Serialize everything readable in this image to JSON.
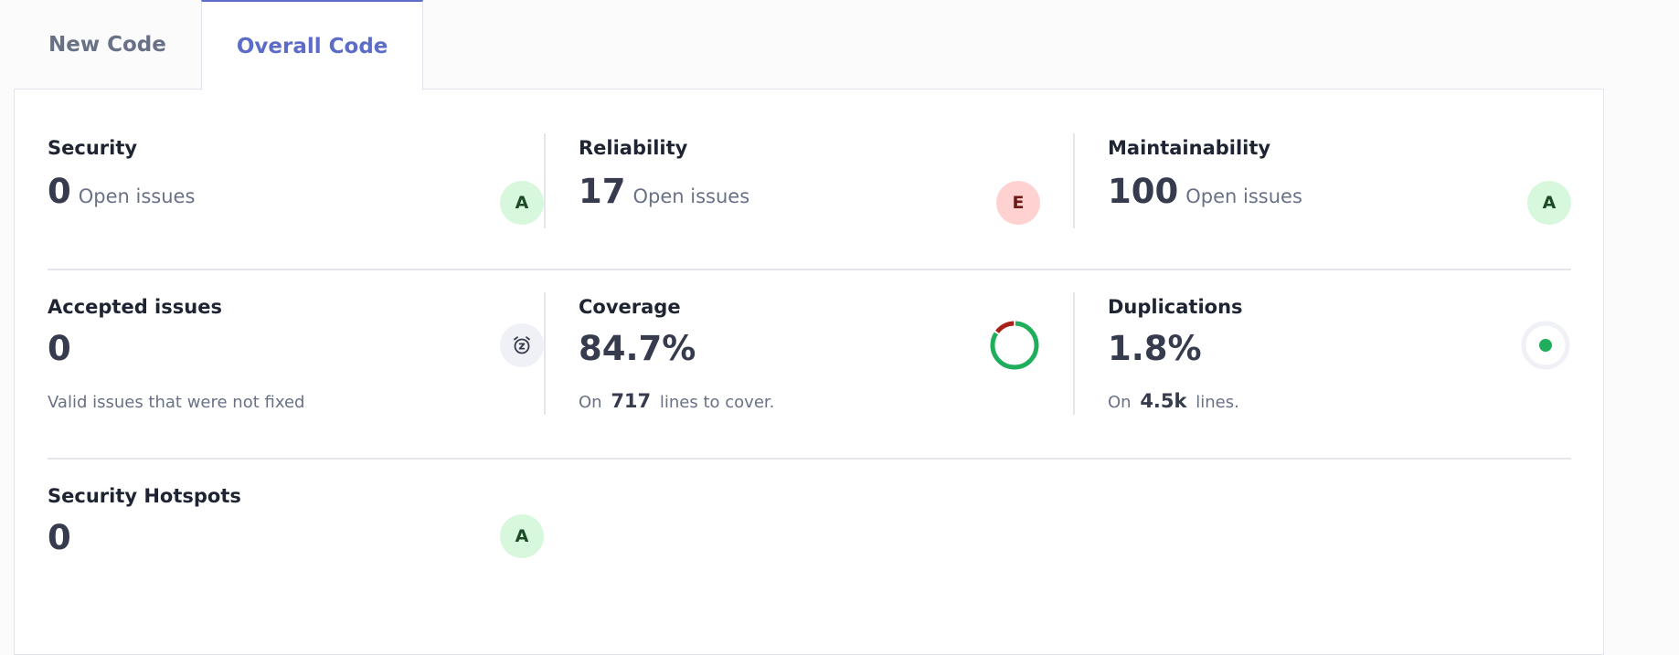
{
  "tabs": [
    {
      "label": "New Code",
      "active": false
    },
    {
      "label": "Overall Code",
      "active": true
    }
  ],
  "security": {
    "title": "Security",
    "value": "0",
    "label": "Open issues",
    "rating": "A"
  },
  "reliability": {
    "title": "Reliability",
    "value": "17",
    "label": "Open issues",
    "rating": "E"
  },
  "maintainability": {
    "title": "Maintainability",
    "value": "100",
    "label": "Open issues",
    "rating": "A"
  },
  "accepted": {
    "title": "Accepted issues",
    "value": "0",
    "description": "Valid issues that were not fixed",
    "icon": "snooze-clock-icon"
  },
  "coverage": {
    "title": "Coverage",
    "value": "84.7%",
    "percent": 84.7,
    "prefix": "On",
    "count": "717",
    "suffix": "lines to cover."
  },
  "duplications": {
    "title": "Duplications",
    "value": "1.8%",
    "prefix": "On",
    "count": "4.5k",
    "suffix": "lines."
  },
  "hotspots": {
    "title": "Security Hotspots",
    "value": "0",
    "rating": "A"
  },
  "colors": {
    "accent": "#5d6cc7",
    "rating_a_bg": "#d8f8dd",
    "rating_e_bg": "#fdd2d0",
    "coverage_good": "#1fae5b",
    "coverage_bad": "#a8201a",
    "duplication_dot": "#1fae5b",
    "duplication_ring": "#eff1f6"
  }
}
